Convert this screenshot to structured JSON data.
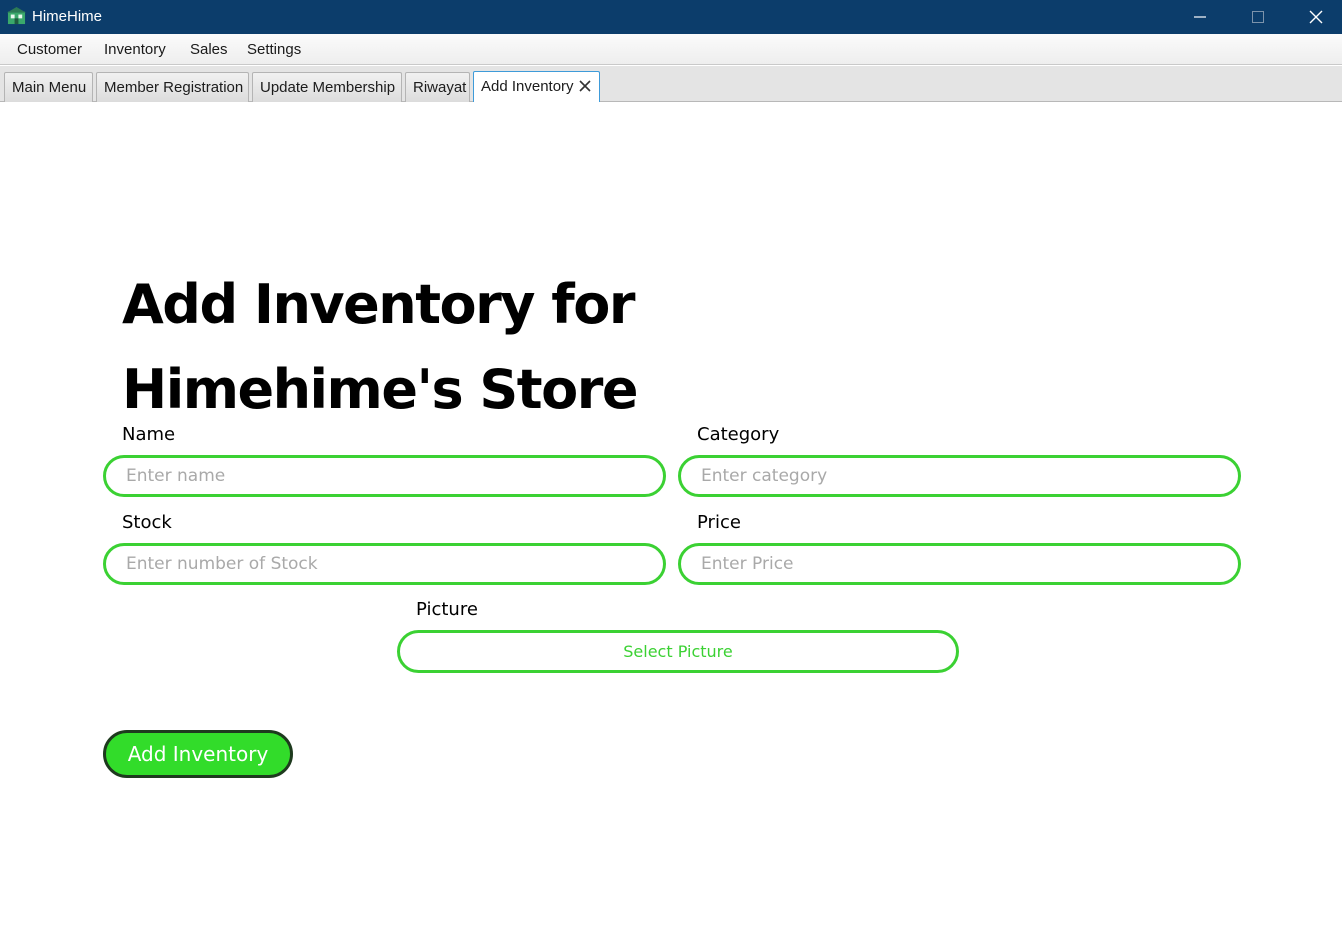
{
  "window": {
    "title": "HimeHime",
    "icon": "store-icon",
    "controls": {
      "minimize": "minimize-icon",
      "maximize": "maximize-icon",
      "close": "close-icon"
    }
  },
  "menu": {
    "items": [
      {
        "label": "Customer"
      },
      {
        "label": "Inventory"
      },
      {
        "label": "Sales"
      },
      {
        "label": "Settings"
      }
    ]
  },
  "tabs": {
    "items": [
      {
        "label": "Main Menu"
      },
      {
        "label": "Member Registration"
      },
      {
        "label": "Update Membership"
      },
      {
        "label": "Riwayat"
      },
      {
        "label": "Add Inventory",
        "active": true,
        "closable": true
      }
    ]
  },
  "form": {
    "heading_line1": "Add Inventory for",
    "heading_line2": "Himehime's Store",
    "name": {
      "label": "Name",
      "placeholder": "Enter name",
      "value": ""
    },
    "category": {
      "label": "Category",
      "placeholder": "Enter category",
      "value": ""
    },
    "stock": {
      "label": "Stock",
      "placeholder": "Enter number of Stock",
      "value": ""
    },
    "price": {
      "label": "Price",
      "placeholder": "Enter Price",
      "value": ""
    },
    "picture": {
      "label": "Picture",
      "button_label": "Select Picture"
    },
    "submit_label": "Add Inventory"
  },
  "colors": {
    "titlebar": "#0c3d6b",
    "accent_green": "#3bd133",
    "button_green": "#32dc2a",
    "button_border": "#1e3a1e",
    "active_tab_border": "#3e9bd9"
  }
}
